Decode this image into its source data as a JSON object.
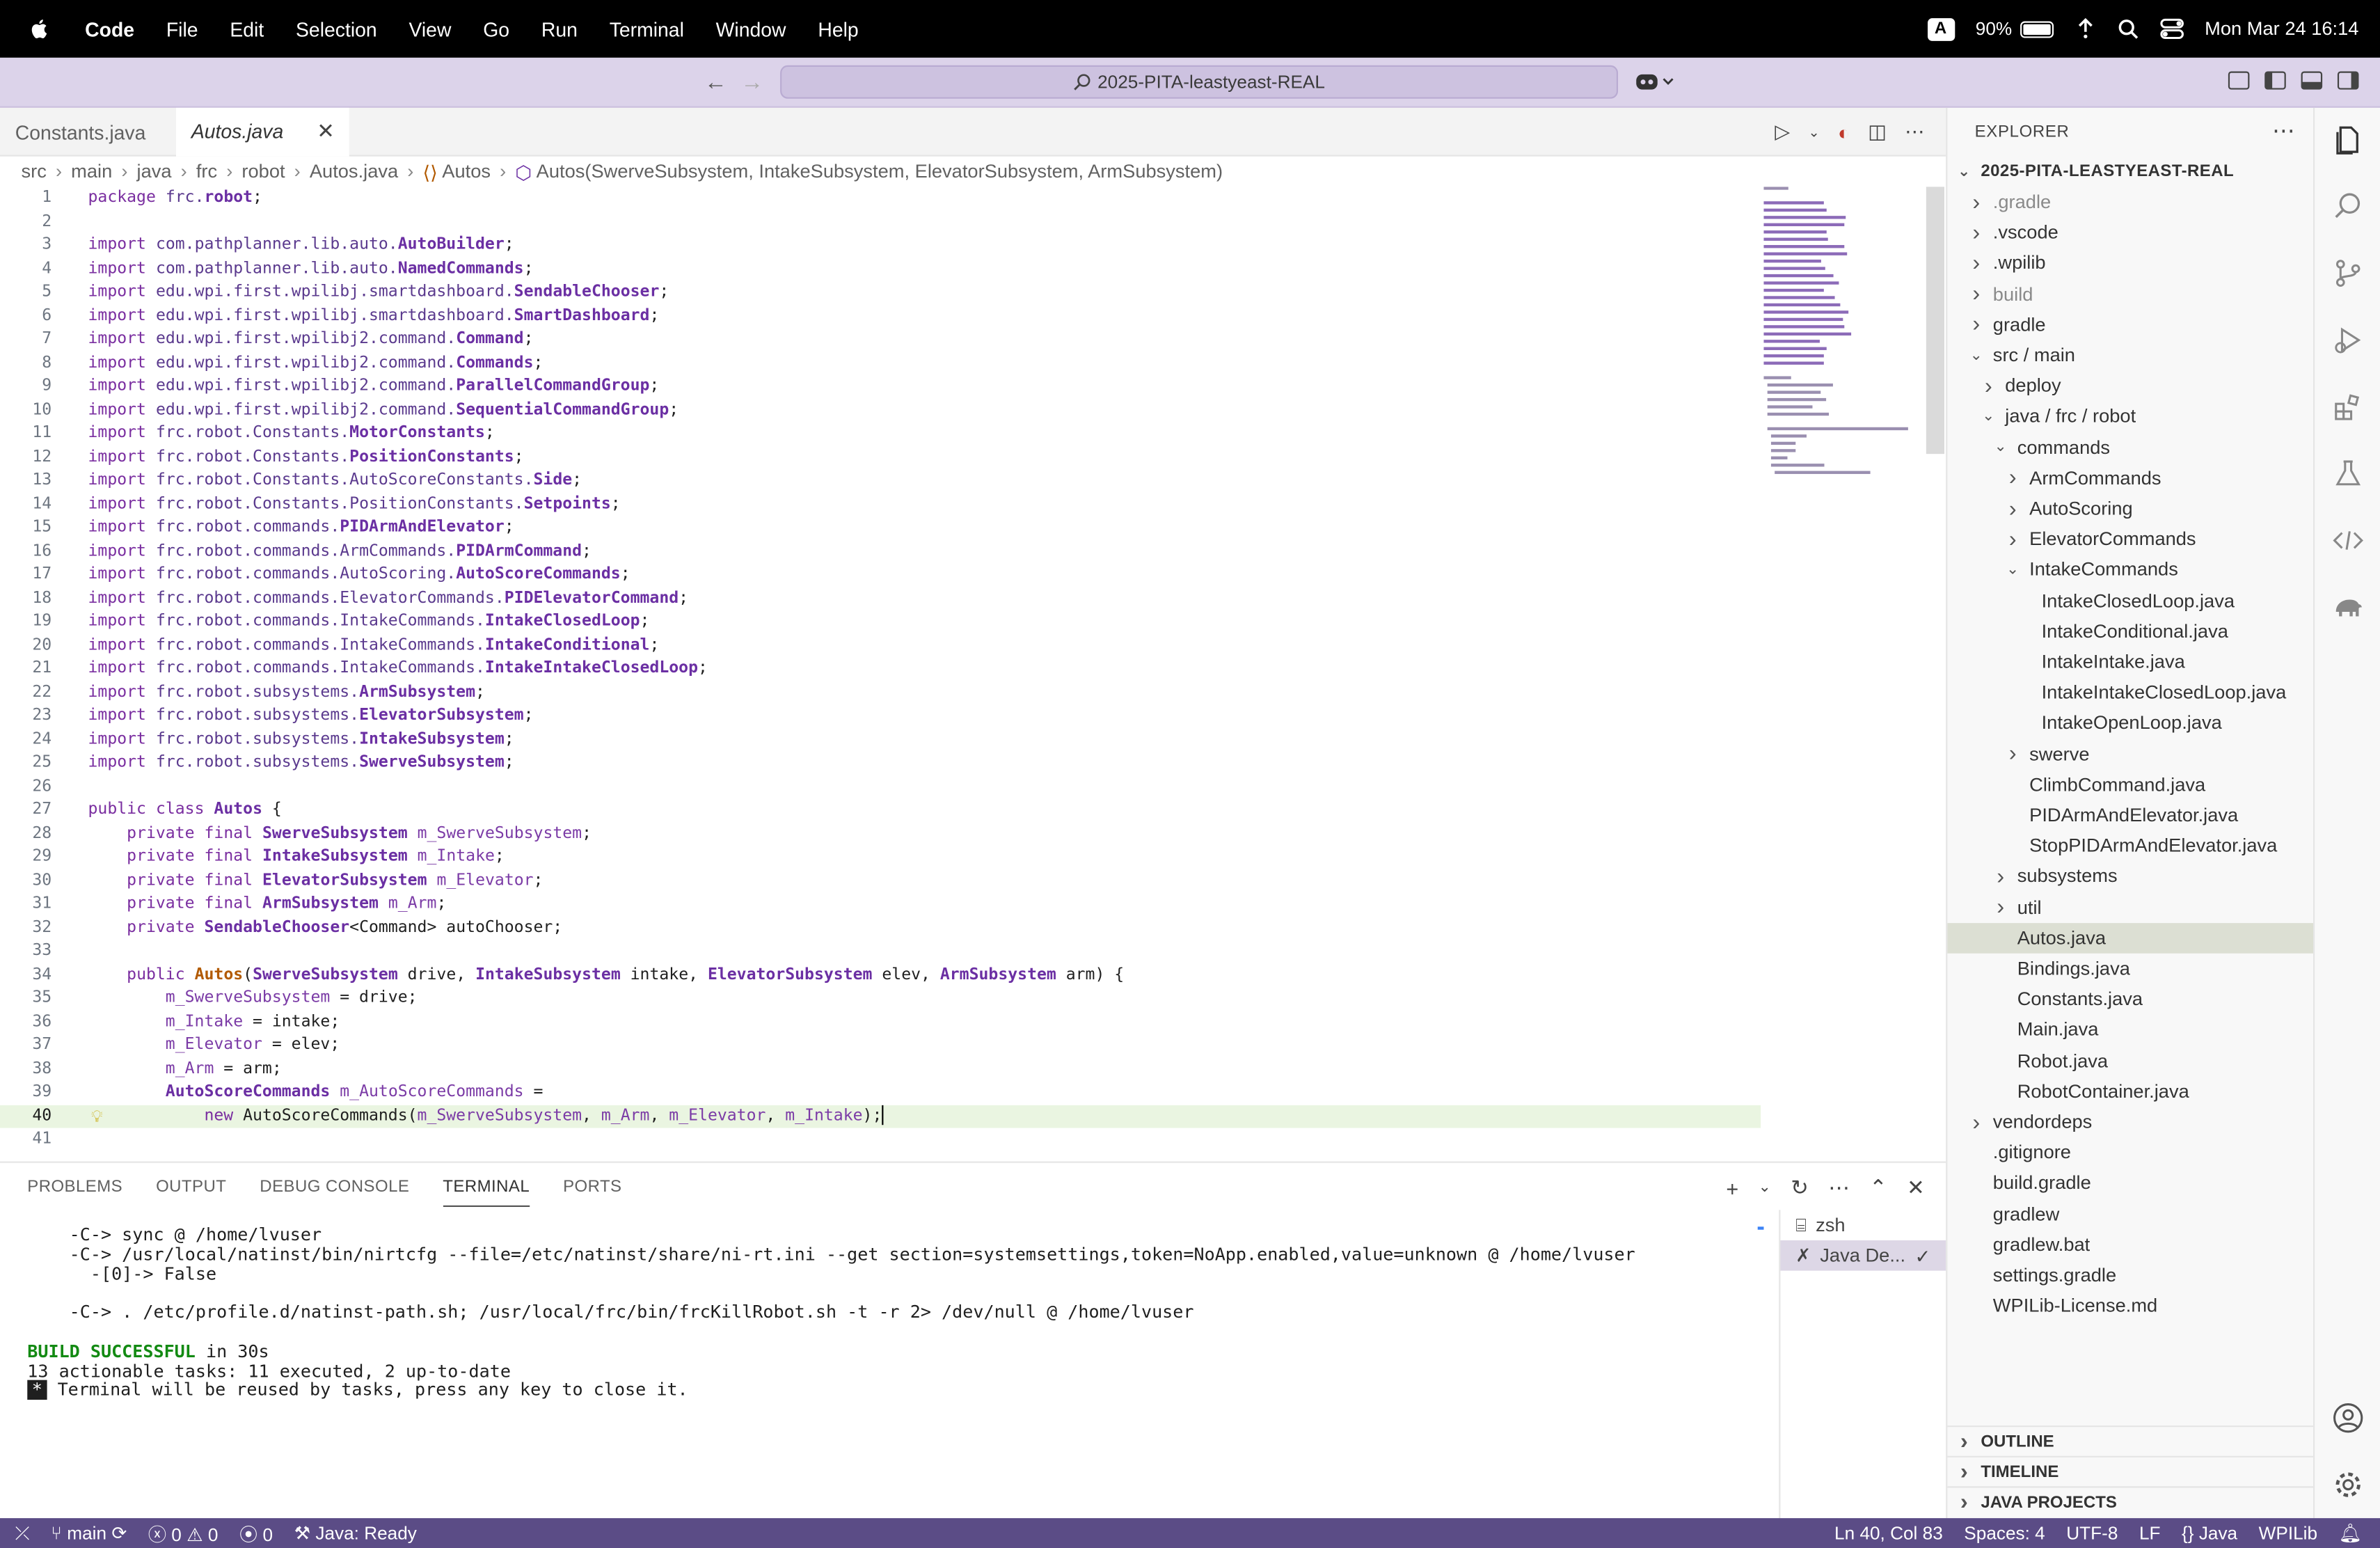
{
  "menubar": {
    "app": "Code",
    "items": [
      "File",
      "Edit",
      "Selection",
      "View",
      "Go",
      "Run",
      "Terminal",
      "Window",
      "Help"
    ],
    "input_source": "A",
    "battery": "90%",
    "battery_level": 0.9,
    "datetime": "Mon Mar 24  16:14"
  },
  "titlebar": {
    "search": "2025-PITA-leastyeast-REAL"
  },
  "tabs": [
    {
      "label": "Constants.java",
      "active": false
    },
    {
      "label": "Autos.java",
      "active": true
    }
  ],
  "breadcrumb": [
    "src",
    "main",
    "java",
    "frc",
    "robot",
    "Autos.java",
    "Autos",
    "Autos(SwerveSubsystem, IntakeSubsystem, ElevatorSubsystem, ArmSubsystem)"
  ],
  "editor": {
    "lines": [
      "package frc.robot;",
      "",
      "import com.pathplanner.lib.auto.AutoBuilder;",
      "import com.pathplanner.lib.auto.NamedCommands;",
      "import edu.wpi.first.wpilibj.smartdashboard.SendableChooser;",
      "import edu.wpi.first.wpilibj.smartdashboard.SmartDashboard;",
      "import edu.wpi.first.wpilibj2.command.Command;",
      "import edu.wpi.first.wpilibj2.command.Commands;",
      "import edu.wpi.first.wpilibj2.command.ParallelCommandGroup;",
      "import edu.wpi.first.wpilibj2.command.SequentialCommandGroup;",
      "import frc.robot.Constants.MotorConstants;",
      "import frc.robot.Constants.PositionConstants;",
      "import frc.robot.Constants.AutoScoreConstants.Side;",
      "import frc.robot.Constants.PositionConstants.Setpoints;",
      "import frc.robot.commands.PIDArmAndElevator;",
      "import frc.robot.commands.ArmCommands.PIDArmCommand;",
      "import frc.robot.commands.AutoScoring.AutoScoreCommands;",
      "import frc.robot.commands.ElevatorCommands.PIDElevatorCommand;",
      "import frc.robot.commands.IntakeCommands.IntakeClosedLoop;",
      "import frc.robot.commands.IntakeCommands.IntakeConditional;",
      "import frc.robot.commands.IntakeCommands.IntakeIntakeClosedLoop;",
      "import frc.robot.subsystems.ArmSubsystem;",
      "import frc.robot.subsystems.ElevatorSubsystem;",
      "import frc.robot.subsystems.IntakeSubsystem;",
      "import frc.robot.subsystems.SwerveSubsystem;",
      "",
      "public class Autos {",
      "    private final SwerveSubsystem m_SwerveSubsystem;",
      "    private final IntakeSubsystem m_Intake;",
      "    private final ElevatorSubsystem m_Elevator;",
      "    private final ArmSubsystem m_Arm;",
      "    private SendableChooser<Command> autoChooser;",
      "",
      "    public Autos(SwerveSubsystem drive, IntakeSubsystem intake, ElevatorSubsystem elev, ArmSubsystem arm) {",
      "        m_SwerveSubsystem = drive;",
      "        m_Intake = intake;",
      "        m_Elevator = elev;",
      "        m_Arm = arm;",
      "        AutoScoreCommands m_AutoScoreCommands =",
      "            new AutoScoreCommands(m_SwerveSubsystem, m_Arm, m_Elevator, m_Intake);",
      ""
    ],
    "current_line": 40
  },
  "panel": {
    "tabs": [
      "PROBLEMS",
      "OUTPUT",
      "DEBUG CONSOLE",
      "TERMINAL",
      "PORTS"
    ],
    "active_tab": "TERMINAL",
    "terminal": [
      "    -C-> sync @ /home/lvuser",
      "    -C-> /usr/local/natinst/bin/nirtcfg --file=/etc/natinst/share/ni-rt.ini --get section=systemsettings,token=NoApp.enabled,value=unknown @ /home/lvuser",
      "      -[0]-> False",
      "",
      "    -C-> . /etc/profile.d/natinst-path.sh; /usr/local/frc/bin/frcKillRobot.sh -t -r 2> /dev/null @ /home/lvuser",
      ""
    ],
    "build_ok": "BUILD SUCCESSFUL",
    "build_time": " in 30s",
    "tasks": "13 actionable tasks: 11 executed, 2 up-to-date",
    "reuse_marker": "*",
    "reuse": " Terminal will be reused by tasks, press any key to close it.",
    "terminals": [
      {
        "label": "zsh",
        "icon": "terminal-icon"
      },
      {
        "label": "Java De...",
        "icon": "tools-icon",
        "selected": true
      }
    ]
  },
  "explorer": {
    "title": "EXPLORER",
    "root": "2025-PITA-LEASTYEAST-REAL",
    "tree": [
      {
        "label": ".gradle",
        "depth": 1,
        "chev": "right",
        "dim": true
      },
      {
        "label": ".vscode",
        "depth": 1,
        "chev": "right"
      },
      {
        "label": ".wpilib",
        "depth": 1,
        "chev": "right"
      },
      {
        "label": "build",
        "depth": 1,
        "chev": "right",
        "dim": true
      },
      {
        "label": "gradle",
        "depth": 1,
        "chev": "right"
      },
      {
        "label": "src / main",
        "depth": 1,
        "chev": "down"
      },
      {
        "label": "deploy",
        "depth": 2,
        "chev": "right"
      },
      {
        "label": "java / frc / robot",
        "depth": 2,
        "chev": "down"
      },
      {
        "label": "commands",
        "depth": 3,
        "chev": "down"
      },
      {
        "label": "ArmCommands",
        "depth": 4,
        "chev": "right"
      },
      {
        "label": "AutoScoring",
        "depth": 4,
        "chev": "right"
      },
      {
        "label": "ElevatorCommands",
        "depth": 4,
        "chev": "right"
      },
      {
        "label": "IntakeCommands",
        "depth": 4,
        "chev": "down"
      },
      {
        "label": "IntakeClosedLoop.java",
        "depth": 5,
        "chev": ""
      },
      {
        "label": "IntakeConditional.java",
        "depth": 5,
        "chev": ""
      },
      {
        "label": "IntakeIntake.java",
        "depth": 5,
        "chev": ""
      },
      {
        "label": "IntakeIntakeClosedLoop.java",
        "depth": 5,
        "chev": ""
      },
      {
        "label": "IntakeOpenLoop.java",
        "depth": 5,
        "chev": ""
      },
      {
        "label": "swerve",
        "depth": 4,
        "chev": "right"
      },
      {
        "label": "ClimbCommand.java",
        "depth": 4,
        "chev": ""
      },
      {
        "label": "PIDArmAndElevator.java",
        "depth": 4,
        "chev": ""
      },
      {
        "label": "StopPIDArmAndElevator.java",
        "depth": 4,
        "chev": ""
      },
      {
        "label": "subsystems",
        "depth": 3,
        "chev": "right"
      },
      {
        "label": "util",
        "depth": 3,
        "chev": "right"
      },
      {
        "label": "Autos.java",
        "depth": 3,
        "chev": "",
        "selected": true
      },
      {
        "label": "Bindings.java",
        "depth": 3,
        "chev": ""
      },
      {
        "label": "Constants.java",
        "depth": 3,
        "chev": ""
      },
      {
        "label": "Main.java",
        "depth": 3,
        "chev": ""
      },
      {
        "label": "Robot.java",
        "depth": 3,
        "chev": ""
      },
      {
        "label": "RobotContainer.java",
        "depth": 3,
        "chev": ""
      },
      {
        "label": "vendordeps",
        "depth": 1,
        "chev": "right"
      },
      {
        "label": ".gitignore",
        "depth": 1,
        "chev": ""
      },
      {
        "label": "build.gradle",
        "depth": 1,
        "chev": ""
      },
      {
        "label": "gradlew",
        "depth": 1,
        "chev": ""
      },
      {
        "label": "gradlew.bat",
        "depth": 1,
        "chev": ""
      },
      {
        "label": "settings.gradle",
        "depth": 1,
        "chev": ""
      },
      {
        "label": "WPILib-License.md",
        "depth": 1,
        "chev": ""
      }
    ],
    "sections": [
      "OUTLINE",
      "TIMELINE",
      "JAVA PROJECTS"
    ]
  },
  "statusbar": {
    "branch": "main",
    "errors": "0",
    "warnings": "0",
    "ports": "0",
    "java_status": "Java: Ready",
    "position": "Ln 40, Col 83",
    "spaces": "Spaces: 4",
    "encoding": "UTF-8",
    "eol": "LF",
    "language": "Java",
    "extension": "WPILib"
  },
  "colors": {
    "titlebar": "#dcd3ea",
    "statusbar": "#5b4c86",
    "current_line": "#eaf5e1",
    "selected_file": "#dcdfd3"
  }
}
